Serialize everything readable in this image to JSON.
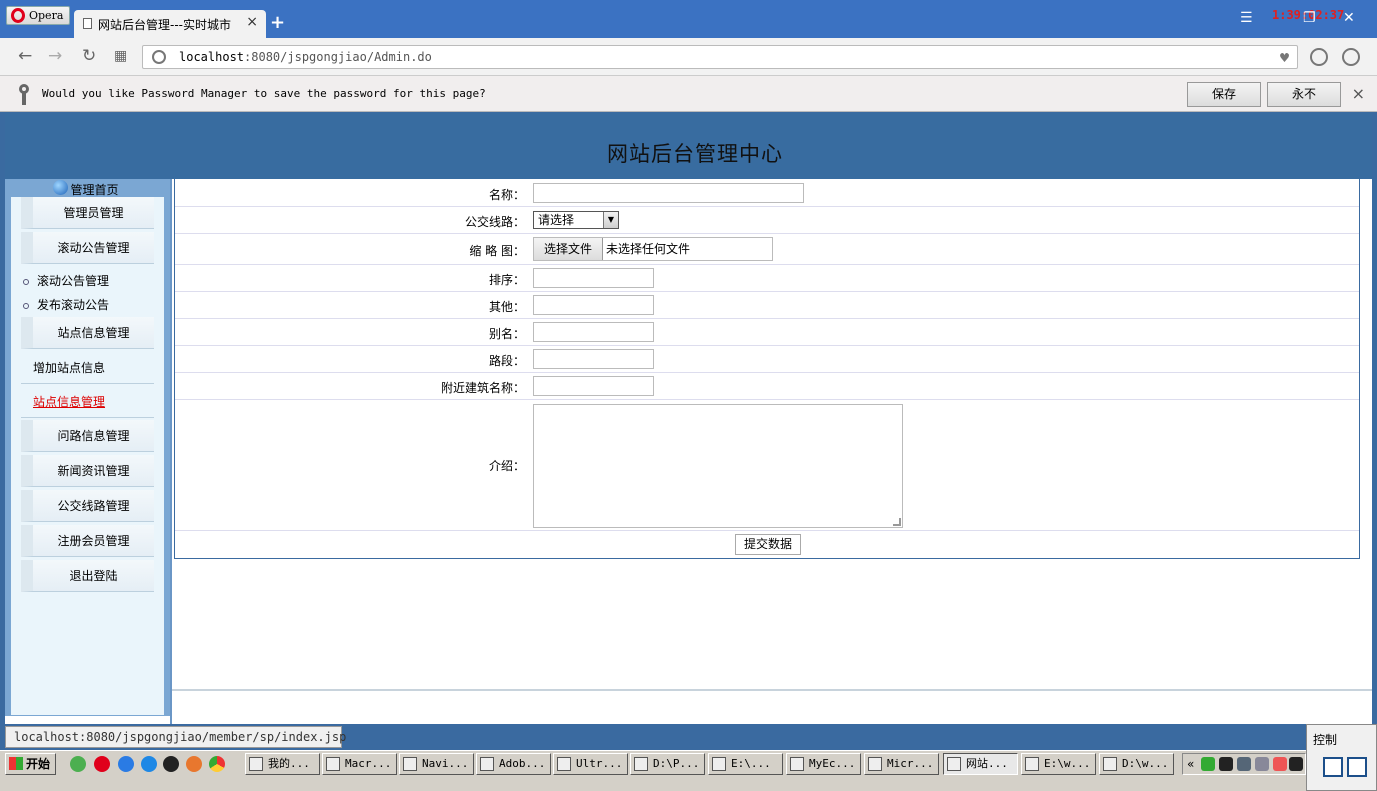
{
  "browser": {
    "opera_button_label": "Opera",
    "tab_title": "网站后台管理---实时城市",
    "tab_close": "×",
    "new_tab": "+",
    "clock": "1:39:02:37",
    "url_host": "localhost",
    "url_path": ":8080/jspgongjiao/Admin.do"
  },
  "password_bar": {
    "message": "Would you like Password Manager to save the password for this page?",
    "save_label": "保存",
    "never_label": "永不",
    "close": "×"
  },
  "page": {
    "banner_title": "网站后台管理中心"
  },
  "sidebar": {
    "home_label": "管理首页",
    "items": [
      {
        "label": "管理员管理",
        "kind": "head"
      },
      {
        "label": "滚动公告管理",
        "kind": "head"
      },
      {
        "label": "滚动公告管理",
        "kind": "sub"
      },
      {
        "label": "发布滚动公告",
        "kind": "sub"
      },
      {
        "label": "站点信息管理",
        "kind": "head"
      },
      {
        "label": "增加站点信息",
        "kind": "plain"
      },
      {
        "label": "站点信息管理",
        "kind": "plain-active"
      },
      {
        "label": "问路信息管理",
        "kind": "head"
      },
      {
        "label": "新闻资讯管理",
        "kind": "head"
      },
      {
        "label": "公交线路管理",
        "kind": "head"
      },
      {
        "label": "注册会员管理",
        "kind": "head"
      },
      {
        "label": "退出登陆",
        "kind": "head"
      }
    ]
  },
  "form": {
    "name_label": "名称：",
    "name_value": "",
    "route_label": "公交线路：",
    "route_selected": "请选择",
    "route_arrow": "▼",
    "thumb_label": "缩 略 图：",
    "file_button": "选择文件",
    "file_status": "未选择任何文件",
    "order_label": "排序：",
    "order_value": "",
    "other_label": "其他：",
    "other_value": "",
    "alias_label": "别名：",
    "alias_value": "",
    "segment_label": "路段：",
    "segment_value": "",
    "building_label": "附近建筑名称：",
    "building_value": "",
    "intro_label": "介绍：",
    "intro_value": "",
    "submit_label": "提交数据"
  },
  "status": {
    "hover_url": "localhost:8080/jspgongjiao/member/sp/index.jsp"
  },
  "control_panel": {
    "label": "控制"
  },
  "taskbar": {
    "start_label": "开始",
    "tasks": [
      "我的...",
      "Macr...",
      "Navi...",
      "Adob...",
      "Ultr...",
      "D:\\P...",
      "E:\\...",
      "MyEc...",
      "Micr...",
      "网站...",
      "E:\\w...",
      "D:\\w..."
    ],
    "tray_chevron": "«"
  },
  "colors": {
    "banner": "#386ca0",
    "sidebar_frame": "#7ba7d3",
    "sidebar_bg": "#eaf5fb",
    "active_link": "#dd0000",
    "clock": "#e02020"
  }
}
